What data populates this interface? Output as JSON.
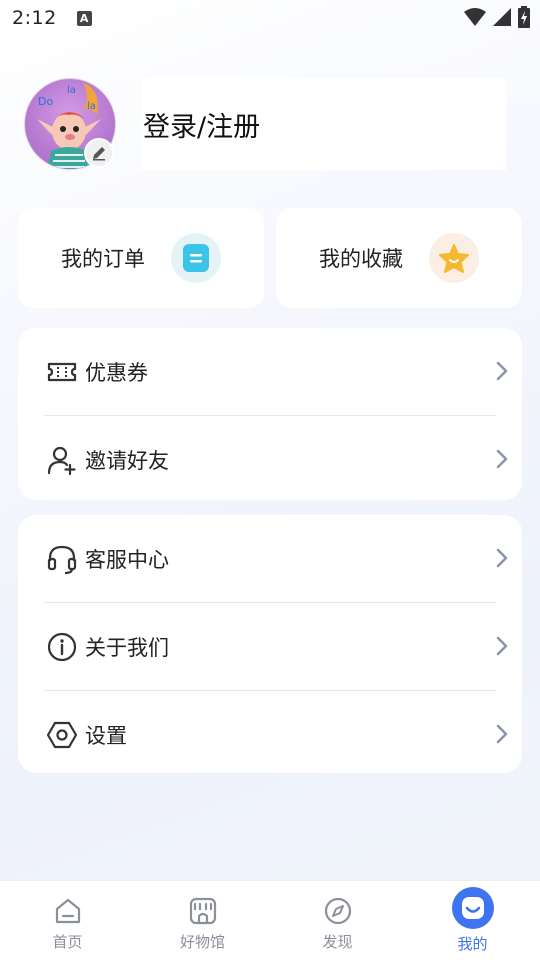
{
  "status_bar": {
    "time": "2:12",
    "notification_icon_letter": "A",
    "icons": [
      "wifi-icon",
      "signal-icon",
      "battery-icon"
    ]
  },
  "profile": {
    "avatar_lettering": [
      "Do",
      "la",
      "la"
    ],
    "login_label": "登录/注册",
    "edit_icon": "pencil-icon"
  },
  "quick_actions": [
    {
      "label": "我的订单",
      "icon": "order-list-icon",
      "icon_color": "#3cc3e8"
    },
    {
      "label": "我的收藏",
      "icon": "star-icon",
      "icon_color": "#f5b82e"
    }
  ],
  "menu_group_1": [
    {
      "label": "优惠券",
      "icon": "coupon-icon"
    },
    {
      "label": "邀请好友",
      "icon": "add-user-icon"
    }
  ],
  "menu_group_2": [
    {
      "label": "客服中心",
      "icon": "headset-icon"
    },
    {
      "label": "关于我们",
      "icon": "info-icon"
    },
    {
      "label": "设置",
      "icon": "settings-hexagon-icon"
    }
  ],
  "tabbar": [
    {
      "label": "首页",
      "icon": "home-icon",
      "active": false
    },
    {
      "label": "好物馆",
      "icon": "shop-icon",
      "active": false
    },
    {
      "label": "发现",
      "icon": "compass-icon",
      "active": false
    },
    {
      "label": "我的",
      "icon": "profile-face-icon",
      "active": true
    }
  ],
  "colors": {
    "accent": "#3f74f0",
    "text_primary": "#222222",
    "chevron": "#8a94a8",
    "tab_inactive": "#8b8f99"
  }
}
